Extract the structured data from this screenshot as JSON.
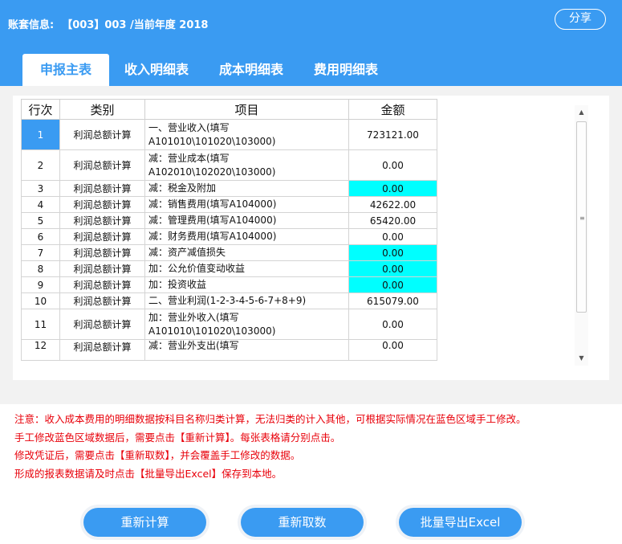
{
  "account": {
    "label": "账套信息:",
    "value": "【003】003 /当前年度 2018"
  },
  "share_label": "分享",
  "tabs": [
    {
      "label": "申报主表",
      "active": true
    },
    {
      "label": "收入明细表",
      "active": false
    },
    {
      "label": "成本明细表",
      "active": false
    },
    {
      "label": "费用明细表",
      "active": false
    }
  ],
  "table": {
    "headers": [
      "行次",
      "类别",
      "项目",
      "金额"
    ],
    "rows": [
      {
        "no": "1",
        "type": "利润总额计算",
        "item": [
          "一、营业收入(填写",
          "A101010\\101020\\103000)"
        ],
        "amount": "723121.00",
        "highlight": false,
        "selected": true
      },
      {
        "no": "2",
        "type": "利润总额计算",
        "item": [
          "减：营业成本(填写",
          "A102010\\102020\\103000)"
        ],
        "amount": "0.00",
        "highlight": false
      },
      {
        "no": "3",
        "type": "利润总额计算",
        "item": [
          "减：税金及附加"
        ],
        "amount": "0.00",
        "highlight": true
      },
      {
        "no": "4",
        "type": "利润总额计算",
        "item": [
          "减：销售费用(填写A104000)"
        ],
        "amount": "42622.00",
        "highlight": false
      },
      {
        "no": "5",
        "type": "利润总额计算",
        "item": [
          "减：管理费用(填写A104000)"
        ],
        "amount": "65420.00",
        "highlight": false
      },
      {
        "no": "6",
        "type": "利润总额计算",
        "item": [
          "减：财务费用(填写A104000)"
        ],
        "amount": "0.00",
        "highlight": false
      },
      {
        "no": "7",
        "type": "利润总额计算",
        "item": [
          "减：资产减值损失"
        ],
        "amount": "0.00",
        "highlight": true
      },
      {
        "no": "8",
        "type": "利润总额计算",
        "item": [
          "加：公允价值变动收益"
        ],
        "amount": "0.00",
        "highlight": true
      },
      {
        "no": "9",
        "type": "利润总额计算",
        "item": [
          "加：投资收益"
        ],
        "amount": "0.00",
        "highlight": true
      },
      {
        "no": "10",
        "type": "利润总额计算",
        "item": [
          "二、营业利润(1-2-3-4-5-6-7+8+9)"
        ],
        "amount": "615079.00",
        "highlight": false
      },
      {
        "no": "11",
        "type": "利润总额计算",
        "item": [
          "加：营业外收入(填写",
          "A101010\\101020\\103000)"
        ],
        "amount": "0.00",
        "highlight": false
      },
      {
        "no": "12",
        "type": "利润总额计算",
        "item": [
          "减：营业外支出(填写"
        ],
        "amount": "0.00",
        "highlight": false,
        "partial": true
      }
    ]
  },
  "notes": [
    "注意：收入成本费用的明细数据按科目名称归类计算，无法归类的计入其他，可根据实际情况在蓝色区域手工修改。",
    "手工修改蓝色区域数据后，需要点击【重新计算】。每张表格请分别点击。",
    "修改凭证后，需要点击【重新取数】，并会覆盖手工修改的数据。",
    "形成的报表数据请及时点击【批量导出Excel】保存到本地。"
  ],
  "buttons": {
    "recalc": "重新计算",
    "refetch": "重新取数",
    "export": "批量导出Excel"
  },
  "colors": {
    "primary": "#3a9bf2",
    "highlight": "#00ffff",
    "note": "#e8000a"
  }
}
